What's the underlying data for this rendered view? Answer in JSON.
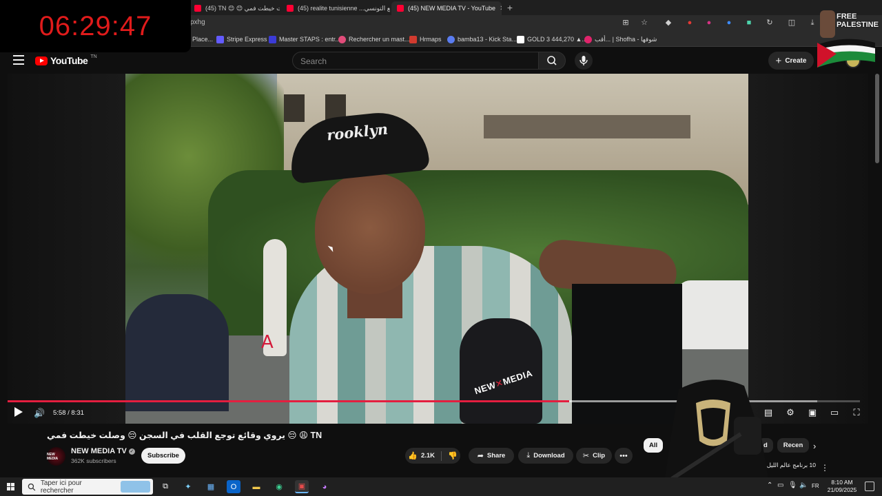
{
  "clock": {
    "time": "06:29:47"
  },
  "browser": {
    "tabs": [
      {
        "label": "(45) TN 😊 😊 وصلت خيطت فمي",
        "active": false
      },
      {
        "label": "(45) realite tunisienne ...وقائع التونسي",
        "active": false
      },
      {
        "label": "(45) NEW MEDIA TV - YouTube",
        "active": true
      }
    ],
    "url_fragment": "pxhg",
    "bookmarks": [
      {
        "label": "Place...",
        "color": "#1877f2"
      },
      {
        "label": "Stripe Express",
        "color": "#635bff"
      },
      {
        "label": "Master STAPS : entr...",
        "color": "#3b3bd6"
      },
      {
        "label": "Rechercher un mast...",
        "color": "#e14c7a"
      },
      {
        "label": "Hrmaps",
        "color": "#d13b2f"
      },
      {
        "label": "bamba13 - Kick Sta...",
        "color": "#5a7cf0"
      },
      {
        "label": "GOLD 3 444,270 ▲...",
        "color": "#ffffff"
      },
      {
        "label": "أقب... | Shofha - شوفها",
        "color": "#e0246b"
      }
    ]
  },
  "overlay": {
    "free_palestine": [
      "FREE",
      "PALESTINE"
    ]
  },
  "youtube": {
    "logo_text": "YouTube",
    "logo_country": "TN",
    "search_placeholder": "Search",
    "create_label": "Create"
  },
  "player": {
    "mic_brand_left": "NEW",
    "mic_brand_right": "MEDIA",
    "cap_text": "rooklyn",
    "time_current": "5:58",
    "time_total": "8:31",
    "time_readout": "5:58 / 8:31",
    "progress_played": 0.659,
    "progress_loaded": 0.95
  },
  "video": {
    "title": "يروي وقائع توجع القلب في السجن 😔 وصلت خيطت فمي 😔 😩 TN",
    "channel": {
      "name": "NEW MEDIA TV",
      "subscribers": "362K subscribers",
      "avatar_text": "NEW MEDIA"
    },
    "subscribe_label": "Subscribe",
    "likes": "2.1K",
    "share_label": "Share",
    "download_label": "Download",
    "clip_label": "Clip"
  },
  "chips": [
    {
      "label": "All",
      "active": true
    },
    {
      "label": "d",
      "active": false
    },
    {
      "label": "Recen",
      "active": false
    }
  ],
  "recommendation_snippet": "10 برنامج عالم الليل",
  "taskbar": {
    "search_placeholder": "Taper ici pour rechercher",
    "language": "FR",
    "time": "8:10 AM",
    "date": "21/09/2025"
  }
}
